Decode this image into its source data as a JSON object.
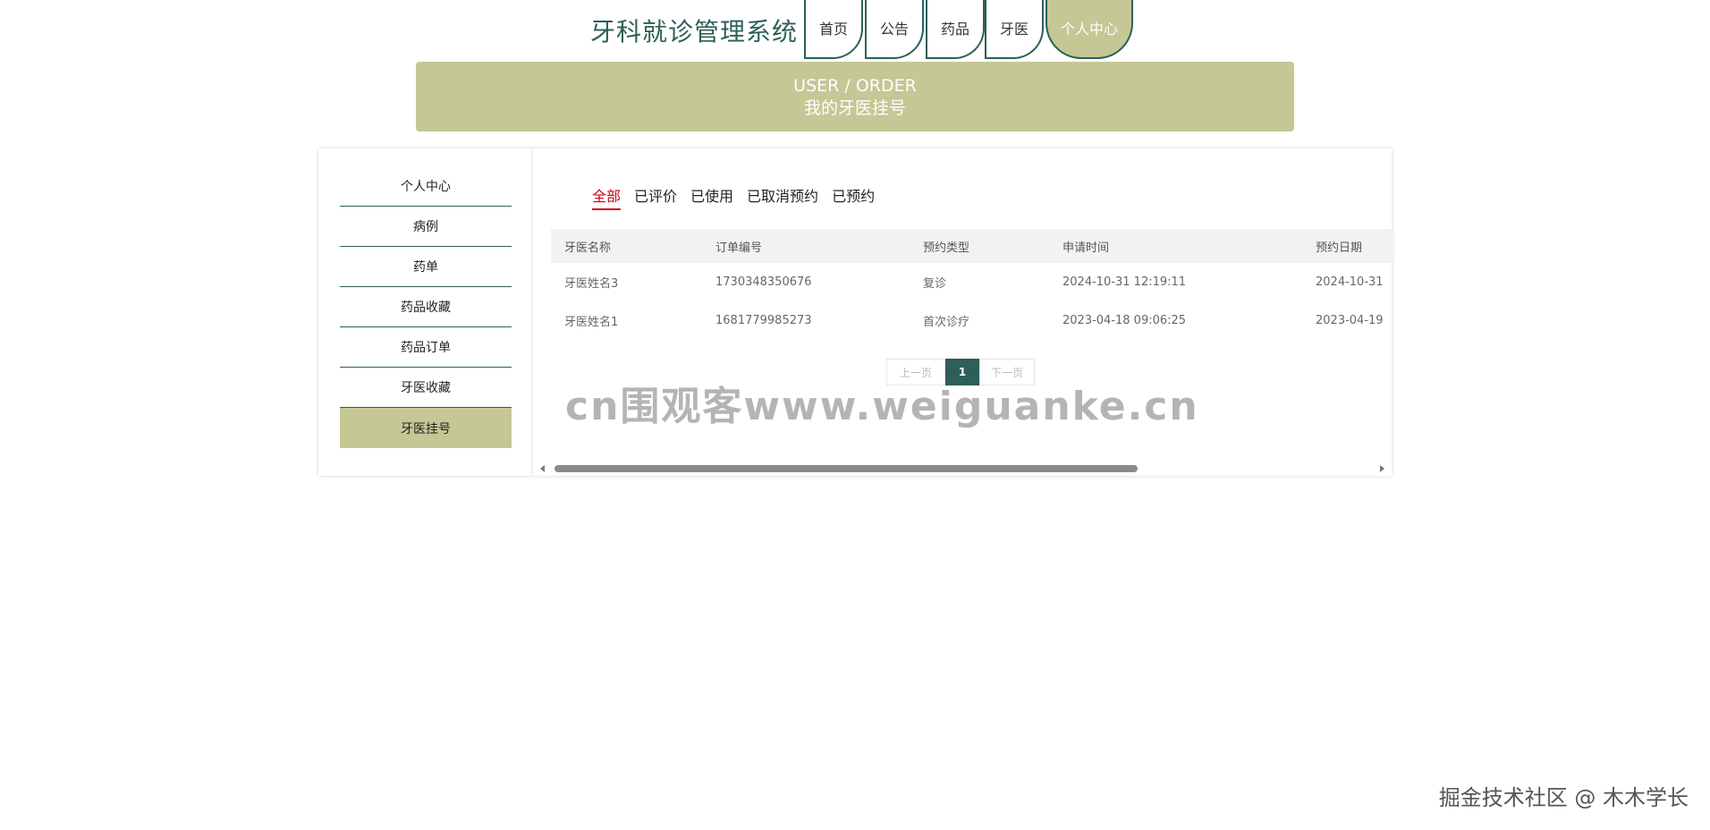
{
  "app_title": "牙科就诊管理系统",
  "nav": [
    {
      "label": "首页"
    },
    {
      "label": "公告"
    },
    {
      "label": "药品"
    },
    {
      "label": "牙医"
    },
    {
      "label": "个人中心",
      "active": true
    }
  ],
  "banner": {
    "en": "USER / ORDER",
    "cn": "我的牙医挂号"
  },
  "sidebar": {
    "items": [
      {
        "label": "个人中心"
      },
      {
        "label": "病例"
      },
      {
        "label": "药单"
      },
      {
        "label": "药品收藏"
      },
      {
        "label": "药品订单"
      },
      {
        "label": "牙医收藏"
      },
      {
        "label": "牙医挂号",
        "active": true
      }
    ]
  },
  "tabs": [
    {
      "label": "全部",
      "active": true
    },
    {
      "label": "已评价"
    },
    {
      "label": "已使用"
    },
    {
      "label": "已取消预约"
    },
    {
      "label": "已预约"
    }
  ],
  "table": {
    "columns": [
      "牙医名称",
      "订单编号",
      "预约类型",
      "申请时间",
      "预约日期"
    ],
    "rows": [
      [
        "牙医姓名3",
        "1730348350676",
        "复诊",
        "2024-10-31 12:19:11",
        "2024-10-31"
      ],
      [
        "牙医姓名1",
        "1681779985273",
        "首次诊疗",
        "2023-04-18 09:06:25",
        "2023-04-19"
      ]
    ]
  },
  "pagination": {
    "prev": "上一页",
    "current": "1",
    "next": "下一页"
  },
  "watermark": "cn围观客www.weiguanke.cn",
  "credit": "掘金技术社区 @ 木木学长",
  "colors": {
    "primary": "#2e5e58",
    "accent": "#c5c795",
    "active_tab": "#d0021b"
  }
}
